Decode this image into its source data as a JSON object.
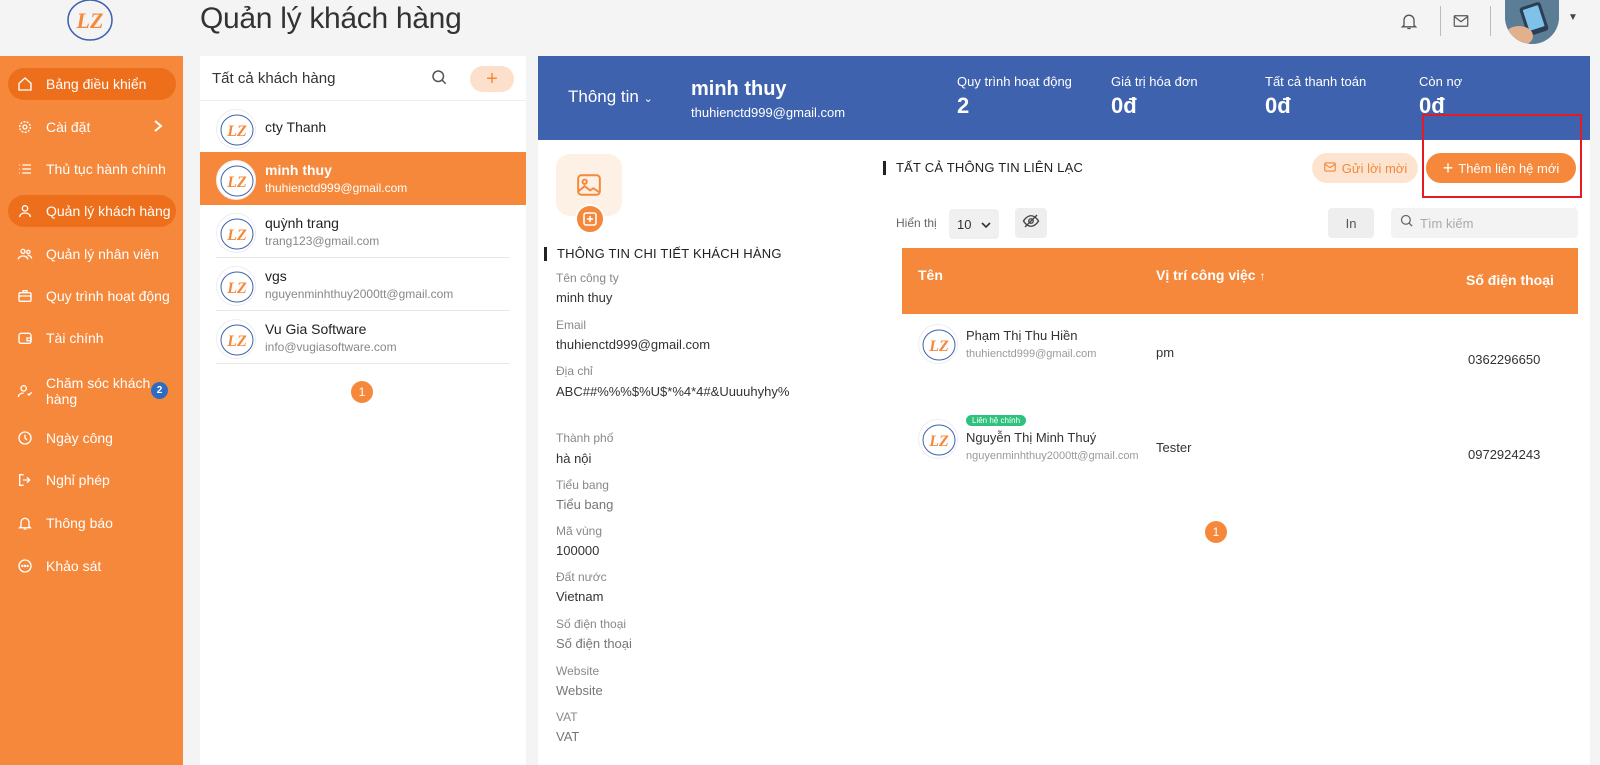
{
  "header": {
    "title": "Quản lý khách hàng",
    "logo_text": "LZ"
  },
  "sidebar": {
    "items": [
      {
        "label": "Bảng điều khiển",
        "icon": "home-icon",
        "active": true
      },
      {
        "label": "Cài đặt",
        "icon": "gear-icon",
        "chevron": true
      },
      {
        "label": "Thủ tục hành chính",
        "icon": "list-icon"
      },
      {
        "label": "Quản lý khách hàng",
        "icon": "user-icon",
        "active": true
      },
      {
        "label": "Quản lý nhân viên",
        "icon": "users-icon"
      },
      {
        "label": "Quy trình hoạt động",
        "icon": "briefcase-icon"
      },
      {
        "label": "Tài chính",
        "icon": "wallet-icon"
      },
      {
        "label": "Chăm sóc khách hàng",
        "icon": "user-care-icon",
        "badge": "2"
      },
      {
        "label": "Ngày công",
        "icon": "clock-icon"
      },
      {
        "label": "Nghỉ phép",
        "icon": "logout-icon"
      },
      {
        "label": "Thông báo",
        "icon": "bell-icon"
      },
      {
        "label": "Khảo sát",
        "icon": "chat-icon"
      }
    ]
  },
  "customer_list": {
    "title": "Tất cả khách hàng",
    "add_label": "+",
    "rows": [
      {
        "name": "cty Thanh",
        "email": ""
      },
      {
        "name": "minh thuy",
        "email": "thuhienctd999@gmail.com",
        "active": true
      },
      {
        "name": "quỳnh trang",
        "email": "trang123@gmail.com"
      },
      {
        "name": "vgs",
        "email": "nguyenminhthuy2000tt@gmail.com"
      },
      {
        "name": "Vu Gia Software",
        "email": "info@vugiasoftware.com"
      }
    ],
    "page": "1"
  },
  "banner": {
    "tab_label": "Thông tin",
    "name": "minh thuy",
    "email": "thuhienctd999@gmail.com",
    "stats": [
      {
        "label": "Quy trình hoạt động",
        "value": "2"
      },
      {
        "label": "Giá trị hóa đơn",
        "value": "0đ"
      },
      {
        "label": "Tất cả thanh toán",
        "value": "0đ"
      },
      {
        "label": "Còn nợ",
        "value": "0đ"
      }
    ]
  },
  "details": {
    "section_title": "THÔNG TIN CHI TIẾT KHÁCH HÀNG",
    "fields": [
      {
        "label": "Tên công ty",
        "value": "minh thuy"
      },
      {
        "label": "Email",
        "value": "thuhienctd999@gmail.com"
      },
      {
        "label": "Địa chỉ",
        "value": "ABC##%%%$%U$*%4*4#&Uuuuhyhy%"
      },
      {
        "label": "Thành phố",
        "value": "hà nội"
      },
      {
        "label": "Tiểu bang",
        "value": "Tiểu bang"
      },
      {
        "label": "Mã vùng",
        "value": "100000"
      },
      {
        "label": "Đất nước",
        "value": "Vietnam"
      },
      {
        "label": "Số điện thoại",
        "value": "Số điện thoại"
      },
      {
        "label": "Website",
        "value": "Website"
      },
      {
        "label": "VAT",
        "value": "VAT"
      }
    ]
  },
  "contacts": {
    "section_title": "TẤT CẢ THÔNG TIN LIÊN LẠC",
    "invite_label": "Gửi lời mời",
    "new_contact_label": "Thêm liên hệ mới",
    "show_label": "Hiển thị",
    "page_size": "10",
    "print_label": "In",
    "search_placeholder": "Tìm kiếm",
    "columns": {
      "name": "Tên",
      "position": "Vị trí công việc",
      "phone": "Số điện thoại"
    },
    "sort_indicator": "↑",
    "rows": [
      {
        "name": "Phạm Thị Thu Hiền",
        "email": "thuhienctd999@gmail.com",
        "position": "pm",
        "phone": "0362296650"
      },
      {
        "name": "Nguyễn Thị Minh Thuý",
        "email": "nguyenminhthuy2000tt@gmail.com",
        "position": "Tester",
        "phone": "0972924243",
        "badge": "Liên hệ chính"
      }
    ],
    "page": "1"
  },
  "colors": {
    "accent": "#f5883a",
    "banner": "#3e62ae",
    "highlight": "#e31c23",
    "badge_green": "#2ec27e"
  }
}
